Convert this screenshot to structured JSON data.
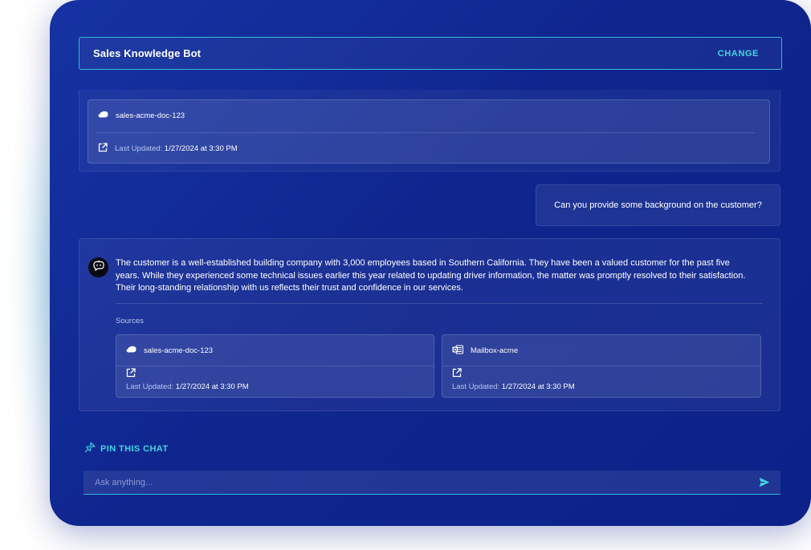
{
  "header": {
    "title": "Sales Knowledge Bot",
    "change_label": "CHANGE"
  },
  "previous_source": {
    "name": "sales-acme-doc-123",
    "icon": "salesforce-cloud-icon",
    "updated_label": "Last Updated:",
    "updated_value": "1/27/2024 at 3:30 PM"
  },
  "user_message": "Can you provide some background on the customer?",
  "bot_message": {
    "text": "The customer is a well-established building company with 3,000 employees based in Southern California. They have been a valued customer for the past five years. While they experienced some technical issues earlier this year related to updating driver information, the matter was promptly resolved to their satisfaction. Their long-standing relationship with us reflects their trust and confidence in our services.",
    "sources_label": "Sources",
    "sources": [
      {
        "name": "sales-acme-doc-123",
        "icon": "salesforce-cloud-icon",
        "updated_label": "Last Updated:",
        "updated_value": "1/27/2024 at 3:30 PM"
      },
      {
        "name": "Mailbox-acme",
        "icon": "outlook-icon",
        "updated_label": "Last Updated:",
        "updated_value": "1/27/2024 at 3:30 PM"
      }
    ]
  },
  "pin_label": "PIN THIS CHAT",
  "input": {
    "placeholder": "Ask anything...",
    "value": ""
  },
  "colors": {
    "accent": "#40d6e0",
    "background": "#0f268f"
  }
}
